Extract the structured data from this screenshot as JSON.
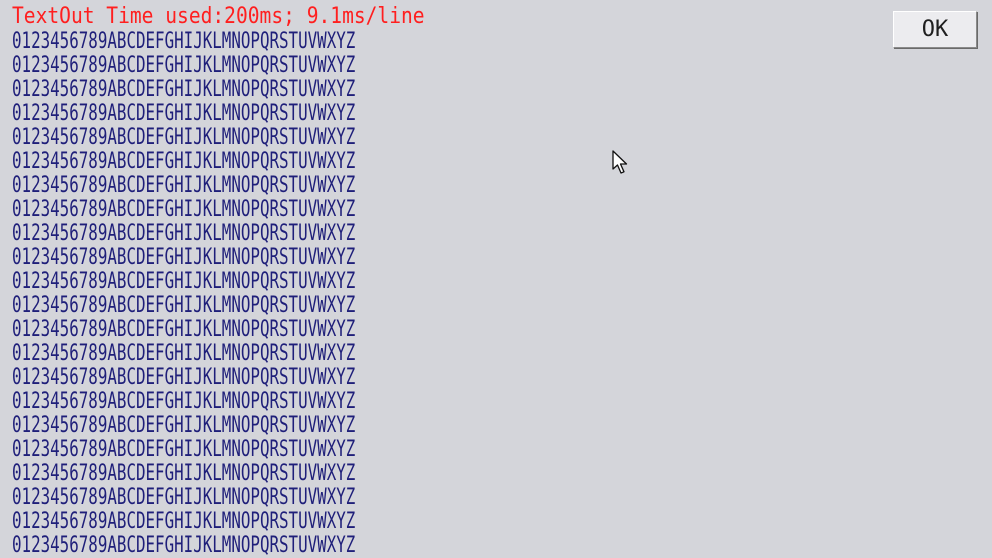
{
  "header": {
    "text": "TextOut Time used:200ms; 9.1ms/line"
  },
  "main": {
    "lines": [
      "0123456789ABCDEFGHIJKLMNOPQRSTUVWXYZ",
      "0123456789ABCDEFGHIJKLMNOPQRSTUVWXYZ",
      "0123456789ABCDEFGHIJKLMNOPQRSTUVWXYZ",
      "0123456789ABCDEFGHIJKLMNOPQRSTUVWXYZ",
      "0123456789ABCDEFGHIJKLMNOPQRSTUVWXYZ",
      "0123456789ABCDEFGHIJKLMNOPQRSTUVWXYZ",
      "0123456789ABCDEFGHIJKLMNOPQRSTUVWXYZ",
      "0123456789ABCDEFGHIJKLMNOPQRSTUVWXYZ",
      "0123456789ABCDEFGHIJKLMNOPQRSTUVWXYZ",
      "0123456789ABCDEFGHIJKLMNOPQRSTUVWXYZ",
      "0123456789ABCDEFGHIJKLMNOPQRSTUVWXYZ",
      "0123456789ABCDEFGHIJKLMNOPQRSTUVWXYZ",
      "0123456789ABCDEFGHIJKLMNOPQRSTUVWXYZ",
      "0123456789ABCDEFGHIJKLMNOPQRSTUVWXYZ",
      "0123456789ABCDEFGHIJKLMNOPQRSTUVWXYZ",
      "0123456789ABCDEFGHIJKLMNOPQRSTUVWXYZ",
      "0123456789ABCDEFGHIJKLMNOPQRSTUVWXYZ",
      "0123456789ABCDEFGHIJKLMNOPQRSTUVWXYZ",
      "0123456789ABCDEFGHIJKLMNOPQRSTUVWXYZ",
      "0123456789ABCDEFGHIJKLMNOPQRSTUVWXYZ",
      "0123456789ABCDEFGHIJKLMNOPQRSTUVWXYZ",
      "0123456789ABCDEFGHIJKLMNOPQRSTUVWXYZ"
    ]
  },
  "buttons": {
    "ok_label": "OK"
  },
  "cursor": {
    "icon": "mouse-pointer-icon"
  },
  "colors": {
    "background": "#d4d5da",
    "header_text": "#ff1f1f",
    "body_text": "#1f1f7a"
  }
}
